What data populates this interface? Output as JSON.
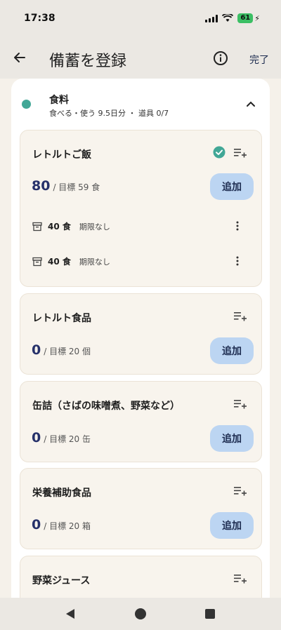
{
  "status": {
    "time": "17:38",
    "battery": "61"
  },
  "appbar": {
    "title": "備蓄を登録",
    "done_label": "完了"
  },
  "category": {
    "name": "食料",
    "summary": "食べる・使う 9.5日分 ・ 道具 0/7",
    "dot_color": "#41a796"
  },
  "items": [
    {
      "title": "レトルトご飯",
      "count": "80",
      "target": "/ 目標 59 食",
      "add_label": "追加",
      "checked": true,
      "stocks": [
        {
          "qty": "40 食",
          "expiry": "期限なし"
        },
        {
          "qty": "40 食",
          "expiry": "期限なし"
        }
      ]
    },
    {
      "title": "レトルト食品",
      "count": "0",
      "target": "/ 目標 20 個",
      "add_label": "追加"
    },
    {
      "title": "缶詰（さばの味噌煮、野菜など）",
      "count": "0",
      "target": "/ 目標 20 缶",
      "add_label": "追加"
    },
    {
      "title": "栄養補助食品",
      "count": "0",
      "target": "/ 目標 20 箱",
      "add_label": "追加"
    },
    {
      "title": "野菜ジュース"
    }
  ],
  "icons": {
    "back": "arrow-left-icon",
    "info": "info-icon",
    "chevron": "chevron-up-icon",
    "list_add": "playlist-add-icon",
    "check": "check-circle-icon",
    "box": "archive-icon",
    "more": "more-vert-icon"
  },
  "colors": {
    "accent": "#26316a",
    "button": "#bcd5f2",
    "check": "#41a796"
  }
}
